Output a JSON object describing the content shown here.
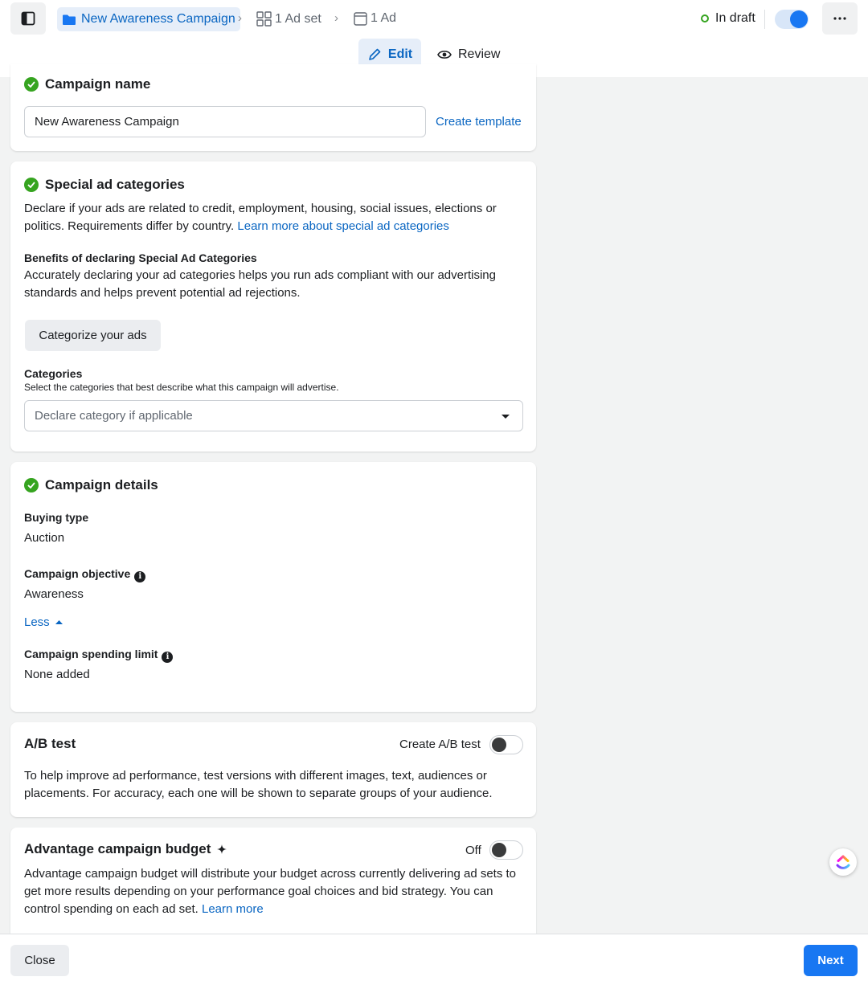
{
  "header": {
    "breadcrumb": {
      "campaign": "New Awareness Campaign",
      "ad_set": "1 Ad set",
      "ad": "1 Ad"
    },
    "status": "In draft",
    "tabs": {
      "edit": "Edit",
      "review": "Review"
    }
  },
  "campaign_name": {
    "title": "Campaign name",
    "value": "New Awareness Campaign",
    "create_template": "Create template"
  },
  "special_ad_categories": {
    "title": "Special ad categories",
    "description": "Declare if your ads are related to credit, employment, housing, social issues, elections or politics. Requirements differ by country.",
    "learn_more": "Learn more about special ad categories",
    "benefits_title": "Benefits of declaring Special Ad Categories",
    "benefits_text": "Accurately declaring your ad categories helps you run ads compliant with our advertising standards and helps prevent potential ad rejections.",
    "categorize_button": "Categorize your ads",
    "categories_label": "Categories",
    "categories_help": "Select the categories that best describe what this campaign will advertise.",
    "categories_placeholder": "Declare category if applicable"
  },
  "campaign_details": {
    "title": "Campaign details",
    "buying_type_label": "Buying type",
    "buying_type_value": "Auction",
    "objective_label": "Campaign objective",
    "objective_value": "Awareness",
    "less_link": "Less",
    "spending_label": "Campaign spending limit",
    "spending_value": "None added"
  },
  "ab_test": {
    "title": "A/B test",
    "toggle_label": "Create A/B test",
    "description": "To help improve ad performance, test versions with different images, text, audiences or placements. For accuracy, each one will be shown to separate groups of your audience."
  },
  "advantage_budget": {
    "title": "Advantage campaign budget",
    "toggle_label": "Off",
    "description": "Advantage campaign budget will distribute your budget across currently delivering ad sets to get more results depending on your performance goal choices and bid strategy. You can control spending on each ad set.",
    "learn_more": "Learn more"
  },
  "footer": {
    "close": "Close",
    "next": "Next"
  },
  "colors": {
    "accent": "#1877f2",
    "link": "#0a66c2",
    "success": "#36a420"
  }
}
